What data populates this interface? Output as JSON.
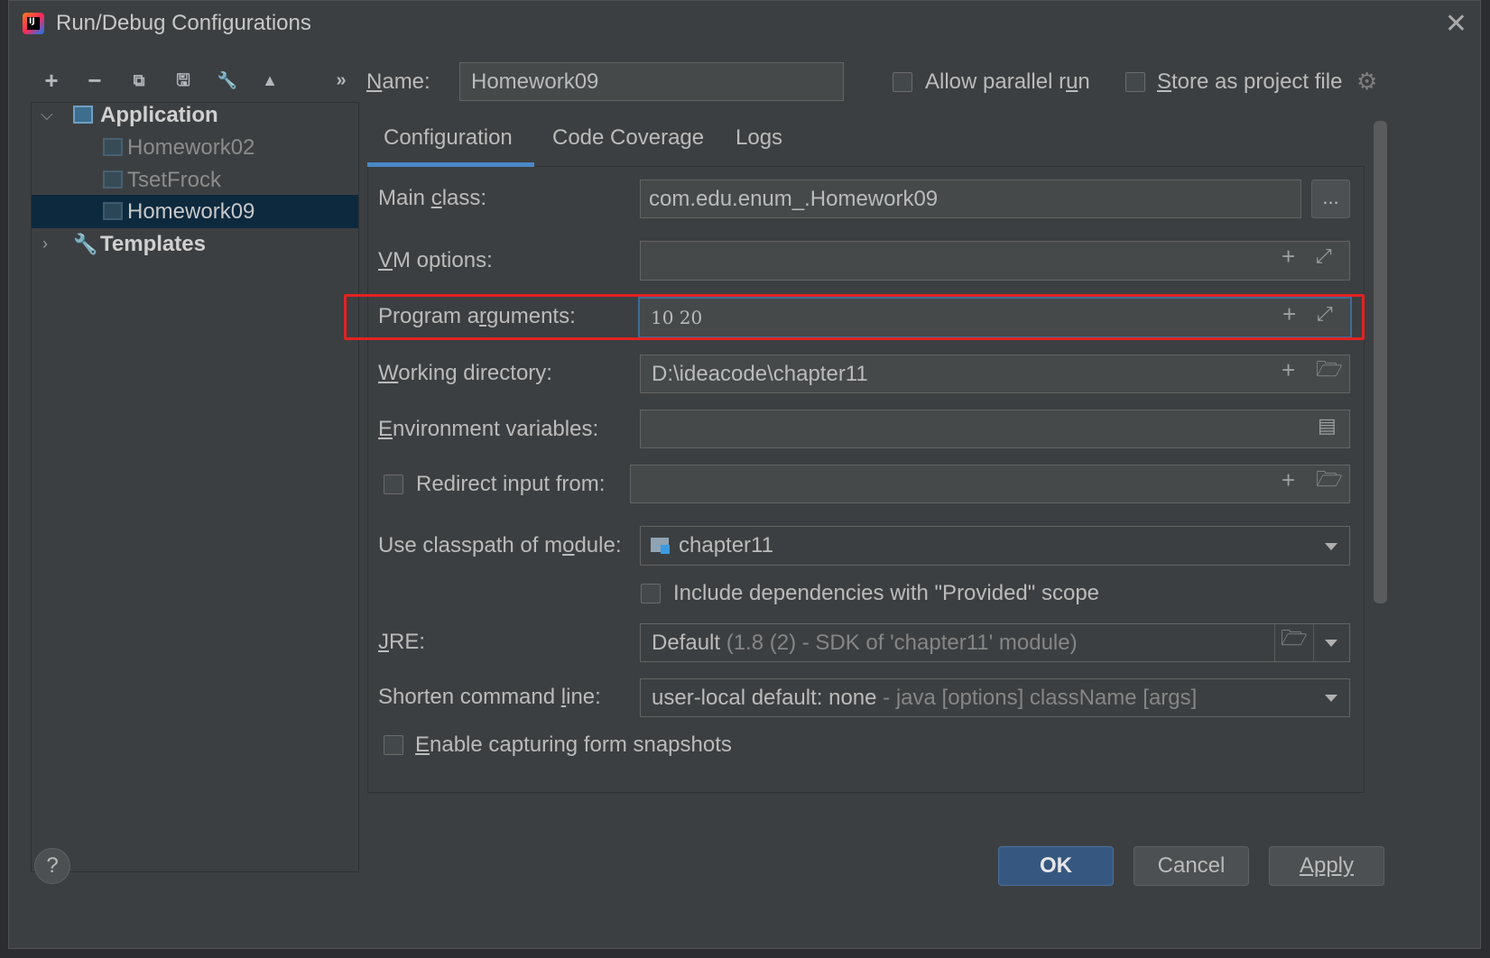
{
  "window": {
    "title": "Run/Debug Configurations",
    "close_icon": "close-icon"
  },
  "toolbar": {
    "add": "+",
    "remove": "−",
    "copy": "⧉",
    "save": "🖫",
    "edit": "🔧",
    "move_up": "▲",
    "more": "»"
  },
  "tree": {
    "application_label": "Application",
    "items": [
      {
        "label": "Homework02"
      },
      {
        "label": "TsetFrock"
      },
      {
        "label": "Homework09"
      }
    ],
    "templates_label": "Templates"
  },
  "header": {
    "name_label_pre": "",
    "name_label_u": "N",
    "name_label_post": "ame:",
    "name_value": "Homework09",
    "allow_parallel_pre": "Allow parallel r",
    "allow_parallel_u": "u",
    "allow_parallel_post": "n",
    "store_pre": "",
    "store_u": "S",
    "store_post": "tore as project file"
  },
  "tabs": [
    "Configuration",
    "Code Coverage",
    "Logs"
  ],
  "config": {
    "main_class_pre": "Main ",
    "main_class_u": "c",
    "main_class_post": "lass:",
    "main_class_value": "com.edu.enum_.Homework09",
    "browse_label": "...",
    "vm_pre": "",
    "vm_u": "V",
    "vm_post": "M options:",
    "vm_value": "",
    "prog_pre": "Program a",
    "prog_u": "r",
    "prog_post": "guments:",
    "prog_value": "10 20",
    "wd_pre": "",
    "wd_u": "W",
    "wd_post": "orking directory:",
    "wd_value": "D:\\ideacode\\chapter11",
    "env_pre": "",
    "env_u": "E",
    "env_post": "nvironment variables:",
    "env_value": "",
    "redirect_label": "Redirect input from:",
    "classpath_pre": "Use classpath of m",
    "classpath_u": "o",
    "classpath_post": "dule:",
    "classpath_value": "chapter11",
    "include_deps": "Include dependencies with \"Provided\" scope",
    "jre_pre": "",
    "jre_u": "J",
    "jre_post": "RE:",
    "jre_value_main": "Default",
    "jre_value_hint": "(1.8 (2) - SDK of 'chapter11' module)",
    "shorten_pre": "Shorten command ",
    "shorten_u": "l",
    "shorten_post": "ine:",
    "shorten_value_main": "user-local default: none",
    "shorten_value_hint": "- java [options] className [args]",
    "snapshots_pre": "",
    "snapshots_u": "E",
    "snapshots_post": "nable capturing form snapshots"
  },
  "buttons": {
    "ok": "OK",
    "cancel": "Cancel",
    "apply": "Apply",
    "help": "?"
  },
  "colors": {
    "accent": "#4a88c7",
    "highlight": "#e22222",
    "ok_bg": "#365880"
  }
}
